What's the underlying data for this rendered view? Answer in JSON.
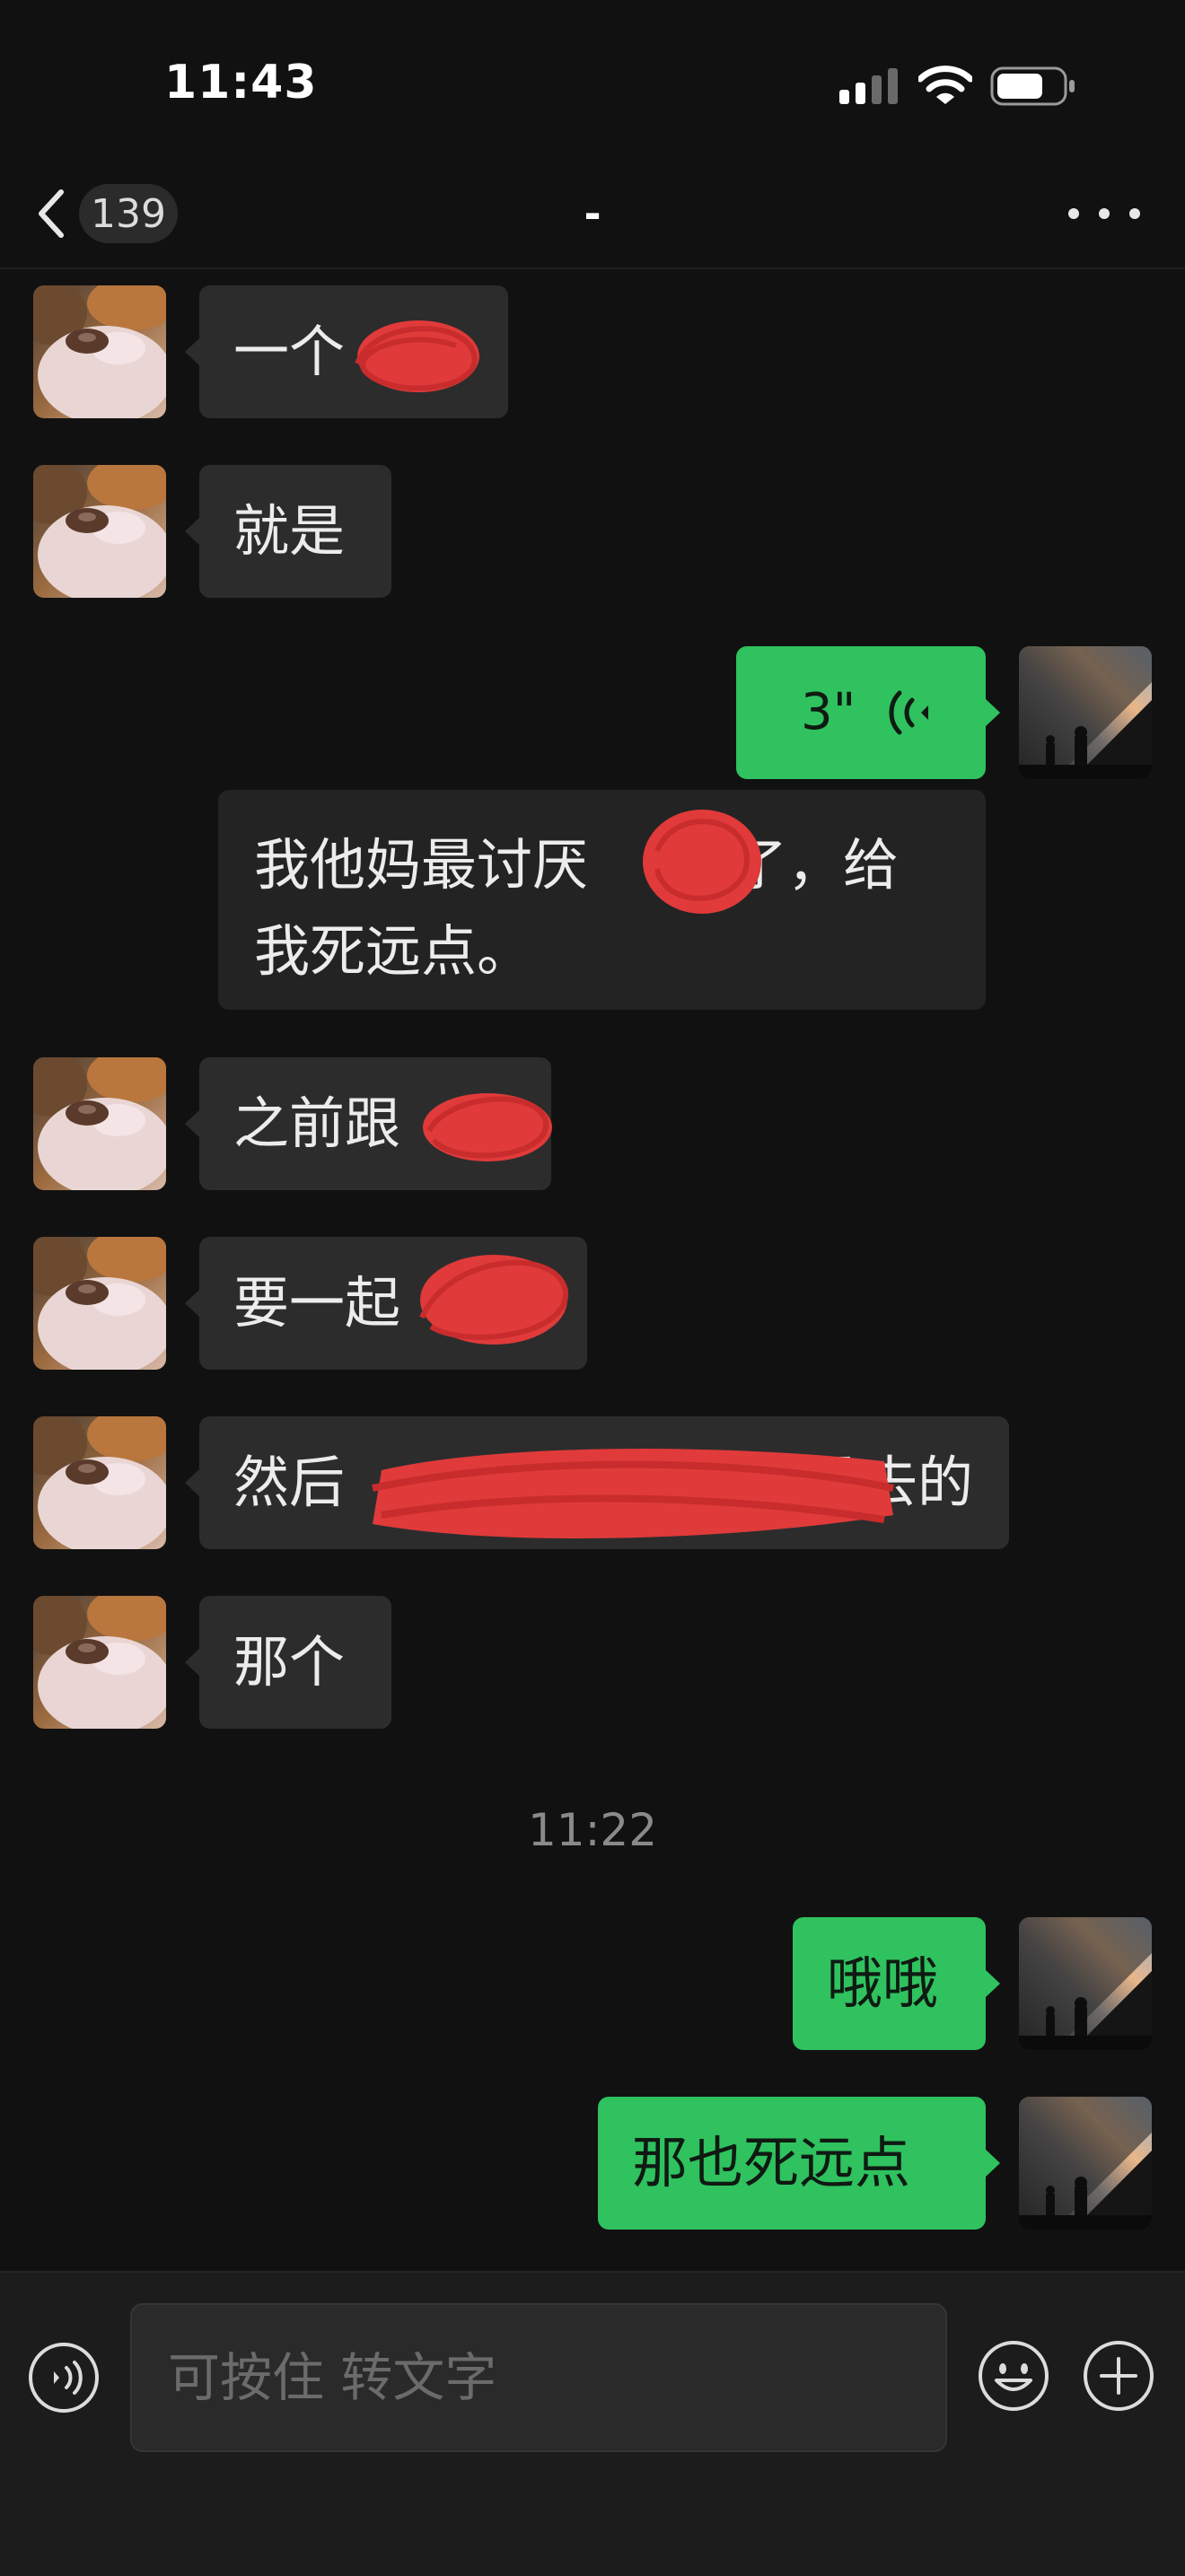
{
  "status_bar": {
    "time": "11:43"
  },
  "nav": {
    "unread_count": "139",
    "title": "-"
  },
  "messages": [
    {
      "side": "in",
      "text": "一个"
    },
    {
      "side": "in",
      "text": "就是"
    },
    {
      "side": "out",
      "type": "voice",
      "duration": "3\""
    },
    {
      "side": "out",
      "type": "voice_transcript",
      "text_line1_a": "我他妈最讨厌",
      "text_line1_b": "了，给",
      "text_line2": "我死远点。"
    },
    {
      "side": "in",
      "text": "之前跟"
    },
    {
      "side": "in",
      "text": "要一起"
    },
    {
      "side": "in",
      "text_a": "然后",
      "text_b": "没去的"
    },
    {
      "side": "in",
      "text": "那个"
    },
    {
      "type": "timestamp",
      "text": "11:22"
    },
    {
      "side": "out",
      "text": "哦哦"
    },
    {
      "side": "out",
      "text": "那也死远点"
    }
  ],
  "input": {
    "placeholder": "可按住 转文字"
  },
  "colors": {
    "background": "#111111",
    "incoming_bubble": "#2c2c2c",
    "outgoing_bubble": "#2fc25f",
    "redaction": "#e03a3a"
  },
  "icons": [
    "back-chevron-icon",
    "more-icon",
    "voice-wave-icon",
    "voice-toggle-icon",
    "emoji-icon",
    "plus-icon",
    "signal-icon",
    "wifi-icon",
    "battery-icon"
  ]
}
